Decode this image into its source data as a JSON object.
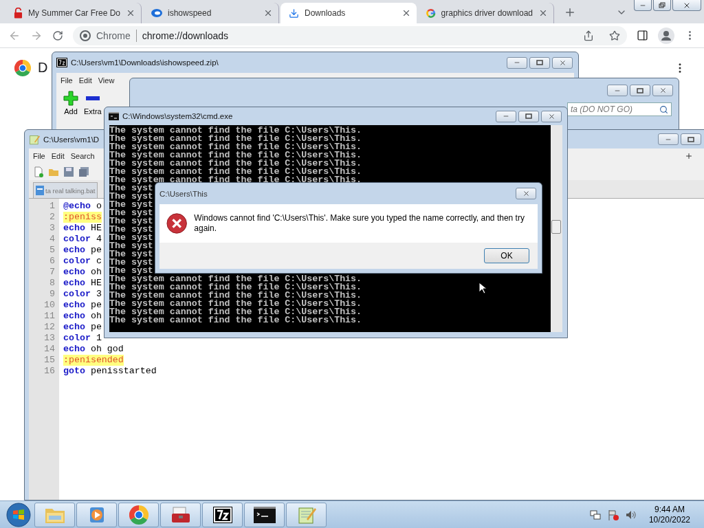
{
  "browser": {
    "tabs": [
      {
        "title": "My Summer Car Free Do",
        "selected": false
      },
      {
        "title": "ishowspeed",
        "selected": false
      },
      {
        "title": "Downloads",
        "selected": true
      },
      {
        "title": "graphics driver download",
        "selected": false
      }
    ],
    "site_label": "Chrome",
    "url": "chrome://downloads",
    "page_heading": "D"
  },
  "archive_window": {
    "title": "C:\\Users\\vm1\\Downloads\\ishowspeed.zip\\",
    "menu": [
      "File",
      "Edit",
      "View"
    ],
    "toolbar": [
      {
        "label": "Add",
        "kind": "add"
      },
      {
        "label": "Extra",
        "kind": "extract"
      }
    ]
  },
  "explorer_window": {
    "search_placeholder": "ta (DO NOT GO)"
  },
  "editor_window": {
    "title": "C:\\Users\\vm1\\D",
    "menu": [
      "File",
      "Edit",
      "Search"
    ],
    "tab": "ta real talking.bat",
    "lines": [
      {
        "number": "1",
        "kind": "command",
        "keyword": "@echo",
        "argument": "o"
      },
      {
        "number": "2",
        "kind": "label",
        "text": ":peniss"
      },
      {
        "number": "3",
        "kind": "command",
        "keyword": "echo",
        "argument": "HE"
      },
      {
        "number": "4",
        "kind": "command",
        "keyword": "color",
        "argument": "4"
      },
      {
        "number": "5",
        "kind": "command",
        "keyword": "echo",
        "argument": "pe"
      },
      {
        "number": "6",
        "kind": "command",
        "keyword": "color",
        "argument": "c"
      },
      {
        "number": "7",
        "kind": "command",
        "keyword": "echo",
        "argument": "oh"
      },
      {
        "number": "8",
        "kind": "command",
        "keyword": "echo",
        "argument": "HE"
      },
      {
        "number": "9",
        "kind": "command",
        "keyword": "color",
        "argument": "3"
      },
      {
        "number": "10",
        "kind": "command",
        "keyword": "echo",
        "argument": "pe"
      },
      {
        "number": "11",
        "kind": "command",
        "keyword": "echo",
        "argument": "oh"
      },
      {
        "number": "12",
        "kind": "command",
        "keyword": "echo",
        "argument": "pe"
      },
      {
        "number": "13",
        "kind": "command",
        "keyword": "color",
        "argument": "1"
      },
      {
        "number": "14",
        "kind": "command",
        "keyword": "echo",
        "argument": "oh god"
      },
      {
        "number": "15",
        "kind": "label",
        "text": ":penisended"
      },
      {
        "number": "16",
        "kind": "command",
        "keyword": "goto",
        "argument": "penisstarted"
      }
    ]
  },
  "console_window": {
    "title": "C:\\Windows\\system32\\cmd.exe",
    "lines": [
      "The system cannot find the file C:\\Users\\This.",
      "The system cannot find the file C:\\Users\\This.",
      "The system cannot find the file C:\\Users\\This.",
      "The system cannot find the file C:\\Users\\This.",
      "The system cannot find the file C:\\Users\\This.",
      "The system cannot find the file C:\\Users\\This.",
      "The system cannot find the file C:\\Users\\This.",
      "The syst",
      "The syst",
      "The syst",
      "The syst",
      "The syst",
      "The syst",
      "The syst",
      "The syst",
      "The syst",
      "The syst",
      "The syst",
      "The system cannot find the file C:\\Users\\This.",
      "The system cannot find the file C:\\Users\\This.",
      "The system cannot find the file C:\\Users\\This.",
      "The system cannot find the file C:\\Users\\This.",
      "The system cannot find the file C:\\Users\\This.",
      "The system cannot find the file C:\\Users\\This."
    ]
  },
  "dialog": {
    "title": "C:\\Users\\This",
    "message": "Windows cannot find 'C:\\Users\\This'. Make sure you typed the name correctly, and then try again.",
    "button": "OK"
  },
  "taskbar": {
    "apps": [
      {
        "kind": "folder"
      },
      {
        "kind": "media"
      },
      {
        "kind": "browser"
      },
      {
        "kind": "toolbox"
      },
      {
        "kind": "archive"
      },
      {
        "kind": "terminal"
      },
      {
        "kind": "notepad"
      }
    ],
    "time": "9:44 AM",
    "date": "10/20/2022"
  }
}
